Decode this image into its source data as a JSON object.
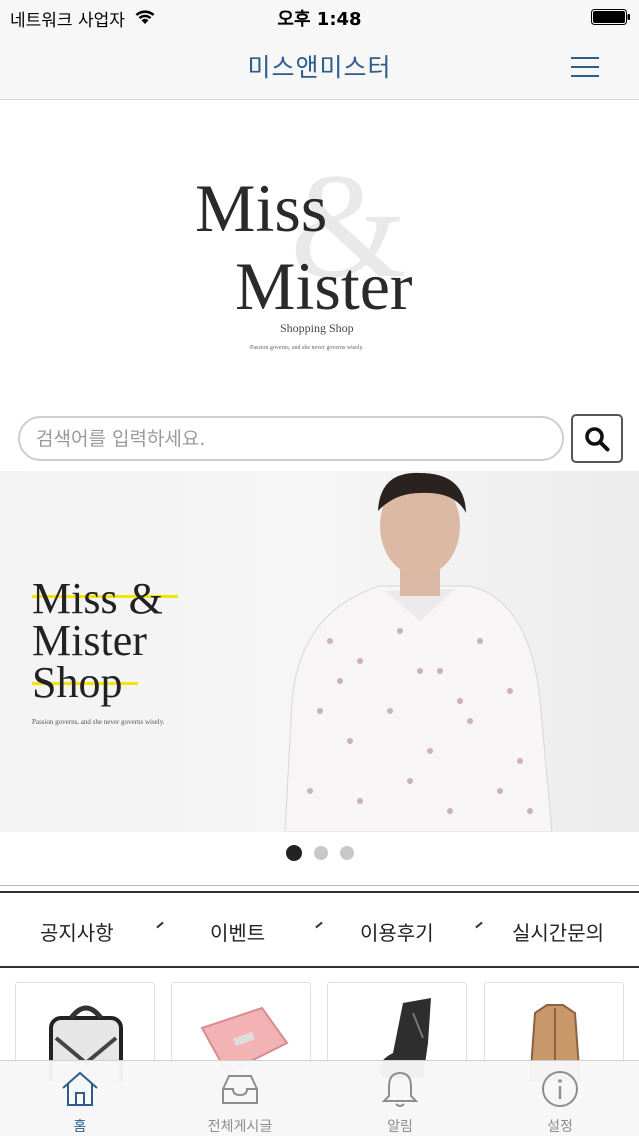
{
  "status_bar": {
    "carrier": "네트워크 사업자",
    "time": "오후 1:48",
    "icons": [
      "wifi-icon",
      "battery-icon"
    ]
  },
  "nav": {
    "title": "미스앤미스터",
    "menu_icon": "hamburger-menu-icon"
  },
  "logo": {
    "line1": "Miss",
    "ampersand": "&",
    "line2": "Mister",
    "subtitle": "Shopping Shop",
    "tagline": "Passion governs, and she never governs wisely."
  },
  "search": {
    "placeholder": "검색어를 입력하세요.",
    "value": "",
    "button_icon": "search-icon"
  },
  "banner": {
    "line1": "Miss &",
    "line2": "Mister",
    "line3": "Shop",
    "tagline": "Passion governs, and she never governs wisely.",
    "pages": 3,
    "active_page": 1
  },
  "categories": {
    "items": [
      "공지사항",
      "이벤트",
      "이용후기",
      "실시간문의"
    ]
  },
  "products": {
    "items": [
      "backpack-thumbnail",
      "pink-wallet-thumbnail",
      "black-ankle-boot-thumbnail",
      "tan-jacket-thumbnail"
    ]
  },
  "tab_bar": {
    "items": [
      {
        "label": "홈",
        "icon": "home-icon",
        "active": true
      },
      {
        "label": "전체게시글",
        "icon": "inbox-icon",
        "active": false
      },
      {
        "label": "알림",
        "icon": "bell-icon",
        "active": false
      },
      {
        "label": "설정",
        "icon": "info-icon",
        "active": false
      }
    ]
  },
  "colors": {
    "accent": "#2c5d8c",
    "highlight": "#f2e600",
    "text": "#222222"
  }
}
